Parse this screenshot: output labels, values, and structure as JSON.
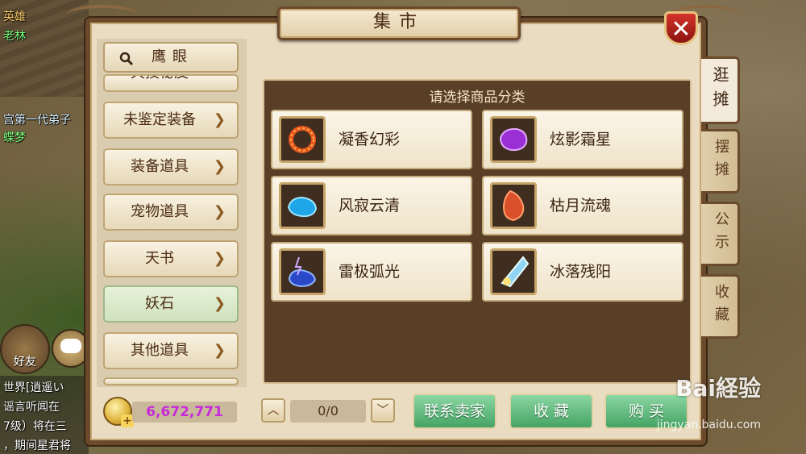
{
  "window": {
    "title": "集市",
    "close_icon": "✕"
  },
  "search": {
    "label": "鹰眼"
  },
  "categories": [
    {
      "label": "天技秘皮",
      "state": "partial"
    },
    {
      "label": "未鉴定装备"
    },
    {
      "label": "装备道具"
    },
    {
      "label": "宠物道具"
    },
    {
      "label": "天书"
    },
    {
      "label": "妖石",
      "state": "selected"
    },
    {
      "label": "其他道具"
    }
  ],
  "content": {
    "title": "请选择商品分类",
    "items": [
      {
        "name": "凝香幻彩",
        "icon": "fire-ring-stone-icon"
      },
      {
        "name": "炫影霜星",
        "icon": "purple-stone-icon"
      },
      {
        "name": "风寂云清",
        "icon": "blue-stone-icon"
      },
      {
        "name": "枯月流魂",
        "icon": "red-stone-icon"
      },
      {
        "name": "雷极弧光",
        "icon": "lightning-stone-icon"
      },
      {
        "name": "冰落残阳",
        "icon": "ice-crystal-icon"
      }
    ]
  },
  "side_tabs": [
    {
      "label": "逛摊",
      "active": true
    },
    {
      "label": "摆摊"
    },
    {
      "label": "公示"
    },
    {
      "label": "收藏"
    }
  ],
  "bottom": {
    "money": "6,672,771",
    "page_indicator": "0/0",
    "contact_seller": "联系卖家",
    "favorite": "收 藏",
    "buy": "购 买"
  },
  "hud": {
    "names": [
      "英雄",
      "老林",
      "宫第一代弟子",
      "蝶梦"
    ],
    "friend_label": "好友",
    "chat_lines": [
      "世界[逍遥い",
      "谣言听闻在",
      "7级）将在三",
      "，期间星君将"
    ]
  },
  "watermark": {
    "brand": "Bai経验",
    "url": "jingyan.baidu.com"
  },
  "colors": {
    "money": "#c62ad9",
    "action_button": "#46a465",
    "frame": "#6b4a2c"
  }
}
